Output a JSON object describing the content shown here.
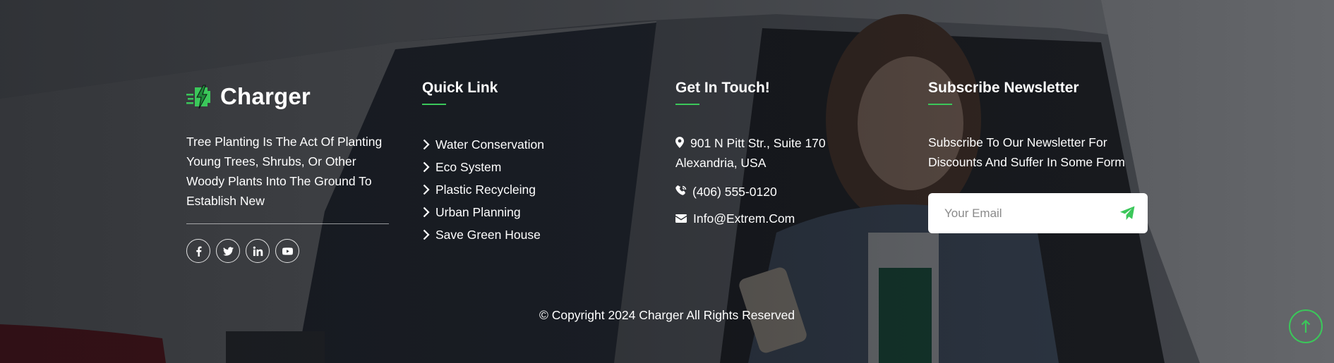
{
  "brand": {
    "name": "Charger",
    "icon": "bolt-battery-icon"
  },
  "about": {
    "text": "Tree Planting Is The Act Of Planting Young Trees, Shrubs, Or Other Woody Plants Into The Ground To Establish New"
  },
  "socials": [
    {
      "icon": "facebook-icon"
    },
    {
      "icon": "twitter-icon"
    },
    {
      "icon": "linkedin-icon"
    },
    {
      "icon": "youtube-icon"
    }
  ],
  "quick_link": {
    "title": "Quick Link",
    "items": [
      {
        "label": "Water Conservation"
      },
      {
        "label": "Eco System"
      },
      {
        "label": "Plastic Recycleing"
      },
      {
        "label": "Urban Planning"
      },
      {
        "label": "Save Green House"
      }
    ]
  },
  "contact": {
    "title": "Get In Touch!",
    "address_line1": "901 N Pitt Str., Suite 170",
    "address_line2": "Alexandria, USA",
    "phone": "(406) 555-0120",
    "email": "Info@Extrem.Com"
  },
  "newsletter": {
    "title": "Subscribe Newsletter",
    "text": "Subscribe To Our Newsletter For Discounts And Suffer In Some Form",
    "placeholder": "Your Email"
  },
  "copyright": "© Copyright 2024 Charger All Rights Reserved",
  "colors": {
    "accent": "#3bc75a",
    "overlay": "#0a0c10"
  }
}
